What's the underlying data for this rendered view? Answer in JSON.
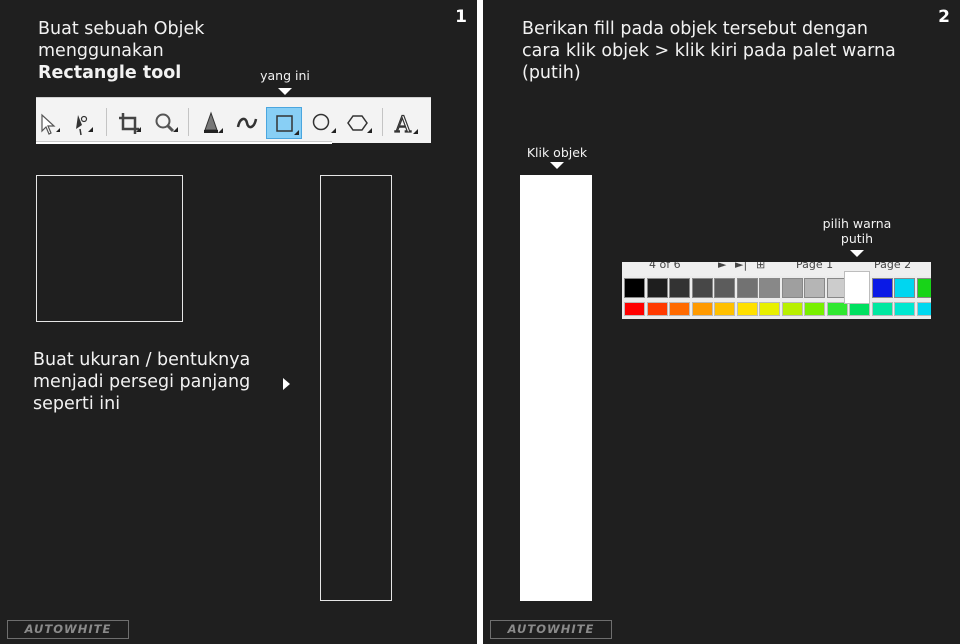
{
  "panel1": {
    "number": "1",
    "heading_line1": "Buat sebuah Objek",
    "heading_line2": "menggunakan",
    "heading_bold": "Rectangle tool",
    "pointer_label": "yang ini",
    "resize_line1": "Buat ukuran / bentuknya",
    "resize_line2": "menjadi persegi panjang",
    "resize_line3": "seperti ini",
    "toolbar": {
      "tools": [
        {
          "name": "pick-tool-icon",
          "active": false
        },
        {
          "name": "shape-tool-icon",
          "active": false
        },
        {
          "name": "crop-tool-icon",
          "active": false
        },
        {
          "name": "zoom-tool-icon",
          "active": false
        },
        {
          "name": "fill-tool-icon",
          "active": false
        },
        {
          "name": "curve-tool-icon",
          "active": false
        },
        {
          "name": "rectangle-tool-icon",
          "active": true
        },
        {
          "name": "ellipse-tool-icon",
          "active": false
        },
        {
          "name": "polygon-tool-icon",
          "active": false
        },
        {
          "name": "text-tool-icon",
          "active": false
        }
      ],
      "text_glyph": "A"
    },
    "logo": "AUTOWHITE"
  },
  "panel2": {
    "number": "2",
    "heading_line1": "Berikan fill pada objek tersebut dengan",
    "heading_line2": "cara klik objek > klik kiri pada palet warna",
    "heading_line3": "(putih)",
    "click_label": "Klik objek",
    "pick_label_line1": "pilih warna",
    "pick_label_line2": "putih",
    "palette": {
      "page_count": "4 of 6",
      "page1": "Page 1",
      "page2": "Page 2",
      "row1_colors": [
        "#000000",
        "#1e1e1e",
        "#333333",
        "#474747",
        "#5c5c5c",
        "#727272",
        "#888888",
        "#9f9f9f",
        "#b5b5b5",
        "#cccccc",
        "#ffffff",
        "#0a1ae6",
        "#00d6f0",
        "#18d418"
      ],
      "row2_colors": [
        "#ff0000",
        "#ff3a00",
        "#ff6a00",
        "#ff9a00",
        "#ffc000",
        "#ffe000",
        "#e8f000",
        "#b8f000",
        "#78f000",
        "#30e830",
        "#00e060",
        "#00e8a0",
        "#00e8d0",
        "#00d8f0"
      ],
      "selected_color": "#ffffff"
    },
    "logo": "AUTOWHITE"
  }
}
